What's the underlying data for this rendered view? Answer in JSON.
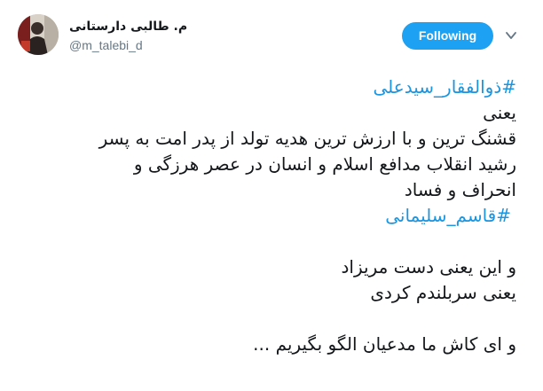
{
  "author": {
    "display_name": "م. طالبی دارستانی",
    "handle": "@m_talebi_d",
    "avatar": "avatar-photo"
  },
  "actions": {
    "follow_label": "Following",
    "more_icon": "chevron-down-icon"
  },
  "colors": {
    "accent": "#1da1f2",
    "hashtag": "#1b95e0",
    "text": "#14171a",
    "secondary": "#657786"
  },
  "tweet": {
    "hashtag_1": "#ذوالفقار_سیدعلی",
    "line_1": "یعنی",
    "line_2": "قشنگ ترین و با ارزش ترین هدیه تولد از پدر امت به پسر",
    "line_3": "رشید انقلاب مدافع اسلام و انسان در عصر هرزگی و",
    "line_4": "انحراف و فساد",
    "hashtag_2": "#قاسم_سلیمانی",
    "line_5": "و این یعنی دست مریزاد",
    "line_6": "یعنی سربلندم کردی",
    "line_7": "و ای کاش ما مدعیان الگو بگیریم ..."
  }
}
